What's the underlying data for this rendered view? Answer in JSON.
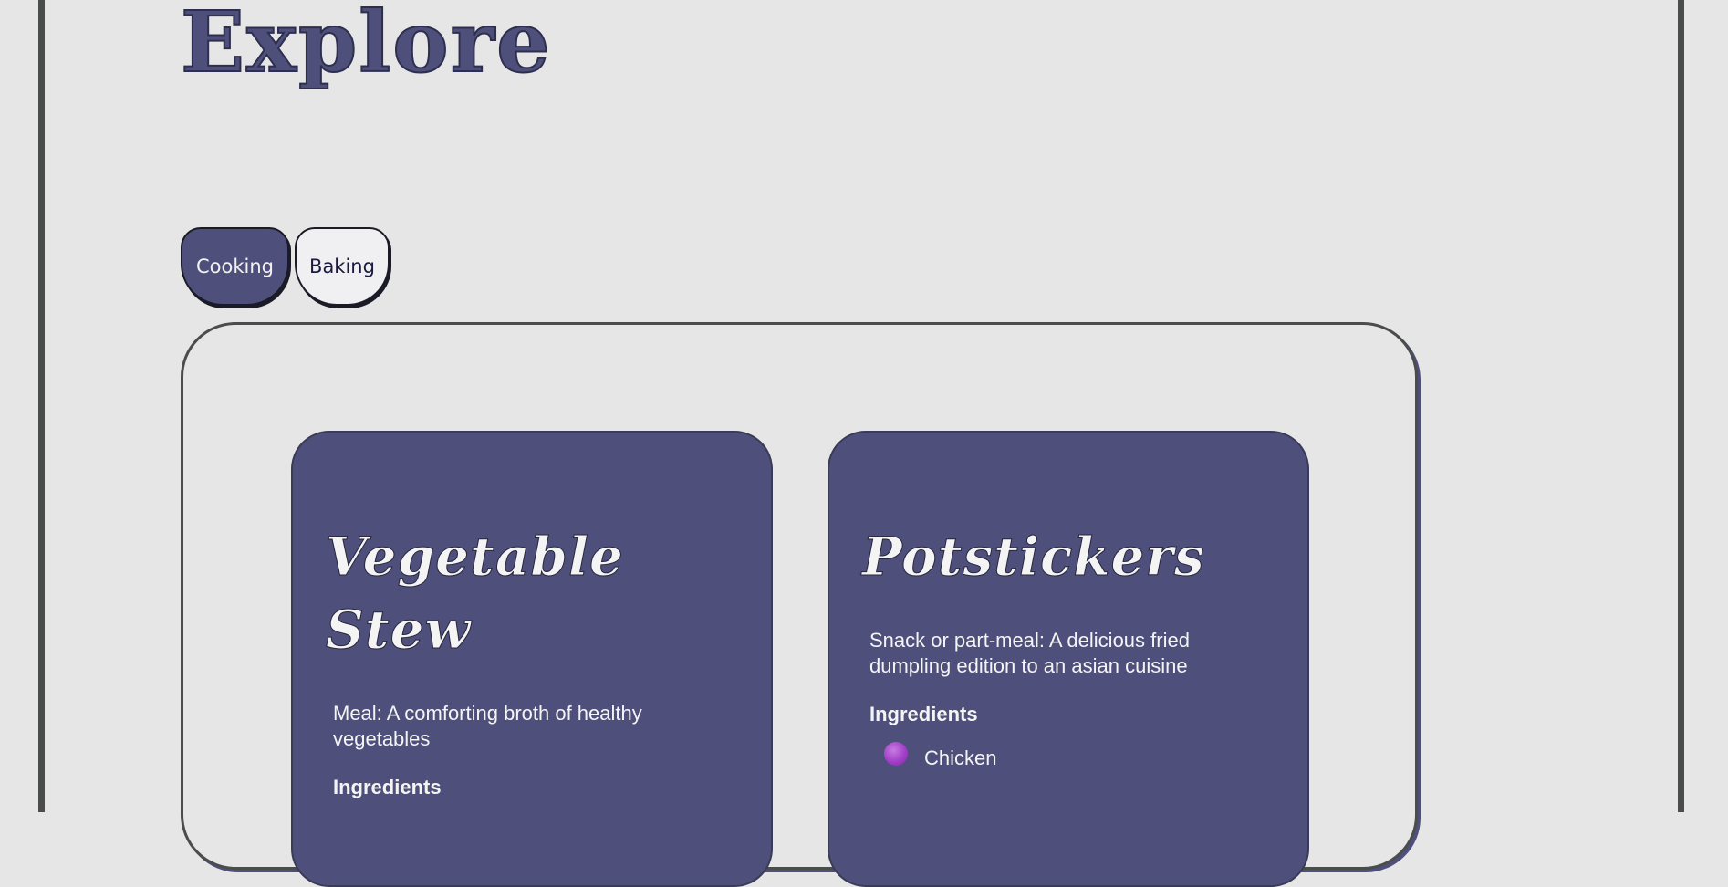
{
  "page": {
    "title": "Explore"
  },
  "tabs": [
    {
      "label": "Cooking",
      "active": true
    },
    {
      "label": "Baking",
      "active": false
    }
  ],
  "recipes": [
    {
      "title": "Vegetable Stew",
      "description": "Meal: A comforting broth of healthy vegetables",
      "ingredients_heading": "Ingredients",
      "ingredients": []
    },
    {
      "title": "Potstickers",
      "description": "Snack or part-meal: A delicious fried dumpling edition to an asian cuisine",
      "ingredients_heading": "Ingredients",
      "ingredients": [
        "Chicken"
      ]
    }
  ],
  "colors": {
    "background": "#e6e6e6",
    "accent": "#4e4f7b",
    "frame_border": "#4a4d4c",
    "bullet": "#a23fc8",
    "card_text": "#f4f4f4"
  },
  "icons": {
    "ingredient_bullet": "purple-dot-icon"
  }
}
